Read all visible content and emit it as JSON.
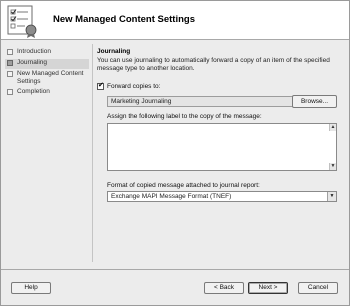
{
  "window": {
    "title": "New Managed Content Settings"
  },
  "nav": {
    "items": [
      {
        "label": "Introduction",
        "active": false
      },
      {
        "label": "Journaling",
        "active": true
      },
      {
        "label": "New Managed Content Settings",
        "active": false
      },
      {
        "label": "Completion",
        "active": false
      }
    ]
  },
  "journaling": {
    "section_title": "Journaling",
    "description": "You can use journaling to automatically forward a copy of an item of the specified message type to another location.",
    "forward_checkbox_label": "Forward copies to:",
    "forward_checked": true,
    "forward_value": "Marketing Journaling",
    "browse_label": "Browse...",
    "label_prompt": "Assign the following label to the copy of the message:",
    "label_value": "",
    "format_label": "Format of copied message attached to journal report:",
    "format_value": "Exchange MAPI Message Format (TNEF)"
  },
  "footer": {
    "help_label": "Help",
    "back_label": "< Back",
    "next_label": "Next >",
    "cancel_label": "Cancel"
  },
  "icons": {
    "wizard": "checklist-document-icon",
    "scroll_up": "scroll-up-arrow-icon",
    "scroll_down": "scroll-down-arrow-icon",
    "dropdown": "chevron-down-icon"
  }
}
